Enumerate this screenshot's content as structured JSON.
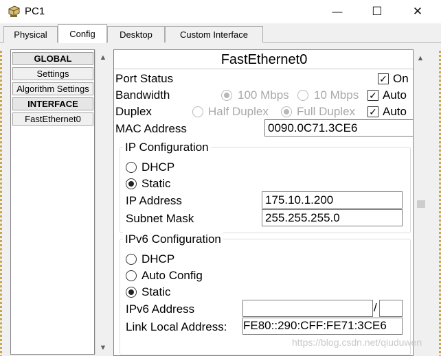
{
  "window": {
    "title": "PC1",
    "minimize_glyph": "—",
    "maximize_glyph": "☐",
    "close_glyph": "✕"
  },
  "tabs": [
    {
      "label": "Physical",
      "active": false
    },
    {
      "label": "Config",
      "active": true
    },
    {
      "label": "Desktop",
      "active": false
    },
    {
      "label": "Custom Interface",
      "active": false
    }
  ],
  "leftnav": {
    "items": [
      {
        "label": "GLOBAL",
        "kind": "header"
      },
      {
        "label": "Settings",
        "kind": "item"
      },
      {
        "label": "Algorithm Settings",
        "kind": "item"
      },
      {
        "label": "INTERFACE",
        "kind": "header"
      },
      {
        "label": "FastEthernet0",
        "kind": "item"
      }
    ]
  },
  "panel": {
    "title": "FastEthernet0",
    "port_status": {
      "label": "Port Status",
      "checkbox_label": "On",
      "checked": true
    },
    "bandwidth": {
      "label": "Bandwidth",
      "options": [
        "100 Mbps",
        "10 Mbps"
      ],
      "selected": "100 Mbps",
      "auto_label": "Auto",
      "auto_checked": true
    },
    "duplex": {
      "label": "Duplex",
      "options": [
        "Half Duplex",
        "Full Duplex"
      ],
      "selected": "Full Duplex",
      "auto_label": "Auto",
      "auto_checked": true
    },
    "mac": {
      "label": "MAC Address",
      "value": "0090.0C71.3CE6"
    },
    "ip_config": {
      "title": "IP Configuration",
      "options": [
        "DHCP",
        "Static"
      ],
      "selected": "Static",
      "ip_label": "IP Address",
      "ip_value": "175.10.1.200",
      "mask_label": "Subnet Mask",
      "mask_value": "255.255.255.0"
    },
    "ipv6_config": {
      "title": "IPv6 Configuration",
      "options": [
        "DHCP",
        "Auto Config",
        "Static"
      ],
      "selected": "Static",
      "addr_label": "IPv6 Address",
      "addr_value": "",
      "prefix_sep": "/",
      "prefix_value": "",
      "link_local_label": "Link Local Address:",
      "link_local_value": "FE80::290:CFF:FE71:3CE6"
    }
  },
  "watermark": "https://blog.csdn.net/qiuduwen",
  "colors": {
    "tab_bg": "#f0f0f0",
    "border": "#adadad",
    "disabled_text": "#a8a8a8"
  }
}
